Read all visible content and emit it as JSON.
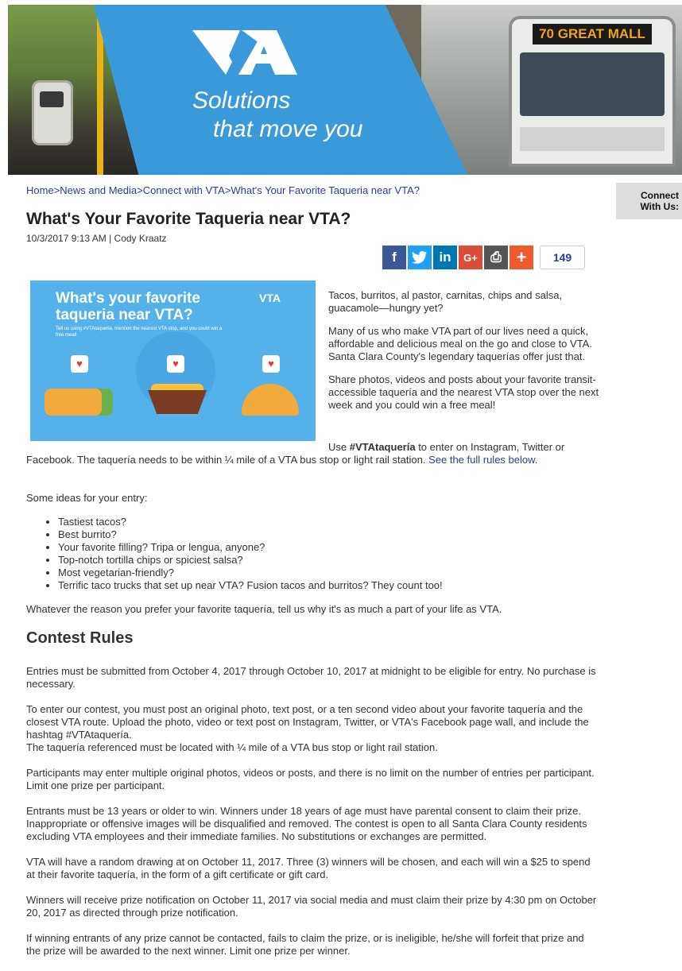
{
  "banner": {
    "tagline_1": "Solutions",
    "tagline_2": "that move you",
    "bus_sign": "70 GREAT MALL",
    "brand_blue": "#3a9ad9"
  },
  "breadcrumb": {
    "home": "Home",
    "news": "News and Media",
    "connect": "Connect with VTA",
    "current": "What's Your Favorite Taqueria near VTA?",
    "separator": ">"
  },
  "article": {
    "title": "What's Your Favorite Taqueria near VTA?",
    "meta": "10/3/2017 9:13 AM | Cody Kraatz"
  },
  "sidebar": {
    "connect_line1": "Connect",
    "connect_line2": "With Us:"
  },
  "share": {
    "facebook": "f",
    "twitter": "t",
    "linkedin": "in",
    "googleplus": "G+",
    "print": "⎙",
    "more": "+",
    "count": "149"
  },
  "promo": {
    "headline": "What's your favorite taqueria near VTA?",
    "subtext": "Tell us using #VTAtaqueria, mention the nearest VTA stop, and you could win a free meal!",
    "logo": "VTA"
  },
  "intro": {
    "p1": "Tacos, burritos, al pastor, carnitas, chips and salsa, guacamole—hungry yet?",
    "p2": "Many of us who make VTA part of our lives need a quick, affordable and delicious meal on the go and close to VTA. Santa Clara County's legendary taquerías offer just that.",
    "p3": "Share photos, videos and posts about your favorite transit-accessible taquería and the nearest VTA stop over the next week and you could win a free meal!",
    "p4_pre": "Use ",
    "p4_hashtag": "#VTAtaquería",
    "p4_post": " to enter on Instagram, Twitter or Facebook. The taquería needs to be within ¼ mile of a VTA bus stop or light rail station. ",
    "p4_link": "See the full rules below."
  },
  "ideas": {
    "heading": "Some ideas for your entry:",
    "items": [
      "Tastiest tacos?",
      "Best burrito?",
      "Your favorite filling? Tripa or lengua, anyone?",
      "Top-notch tortilla chips or spiciest salsa?",
      "Most vegetarian-friendly?",
      "Terrific taco trucks that set up near VTA? Fusion tacos and burritos? They count too!"
    ],
    "closing": "Whatever the reason you prefer your favorite taquería, tell us why it's as much a part of your life as VTA."
  },
  "rules": {
    "heading": "Contest Rules",
    "p1": "Entries must be submitted from October 4, 2017 through October 10, 2017 at midnight to be eligible for entry. No purchase is necessary.",
    "p2a": "To enter our contest, you must post an original photo, text post, or a ten second video about your favorite taquería and the closest VTA route. Upload the photo, video or text post on Instagram, Twitter, or VTA's Facebook page wall, and include the hashtag #VTAtaquería.",
    "p2b": "The taquería referenced must be located with ¼ mile of a VTA bus stop or light rail station.",
    "p3": "Participants may enter multiple original photos, videos or posts, and there is no limit on the number of entries per participant. Limit one prize per participant.",
    "p4": "Entrants must be 13 years or older to win. Winners under 18 years of age must have parental consent to claim their prize. Inappropriate or offensive images will be disqualified and removed. The contest is open to all Santa Clara County residents excluding VTA employees and their immediate families. No substitutions or exchanges are permitted.",
    "p5": "VTA will have a random drawing at on October 11, 2017. Three (3) winners will be chosen, and each will win a $25 to spend at their favorite taquería, in the form of a gift certificate or gift card.",
    "p6": "Winners will receive prize notification on October 11, 2017 via social media and must claim their prize by 4:30 pm on October 20, 2017 as directed through prize notification.",
    "p7": "If winning entrants of any prize cannot be contacted, fails to claim the prize, or is ineligible, he/she will forfeit that prize and the prize will be awarded to the next winner. Limit one prize per winner."
  }
}
